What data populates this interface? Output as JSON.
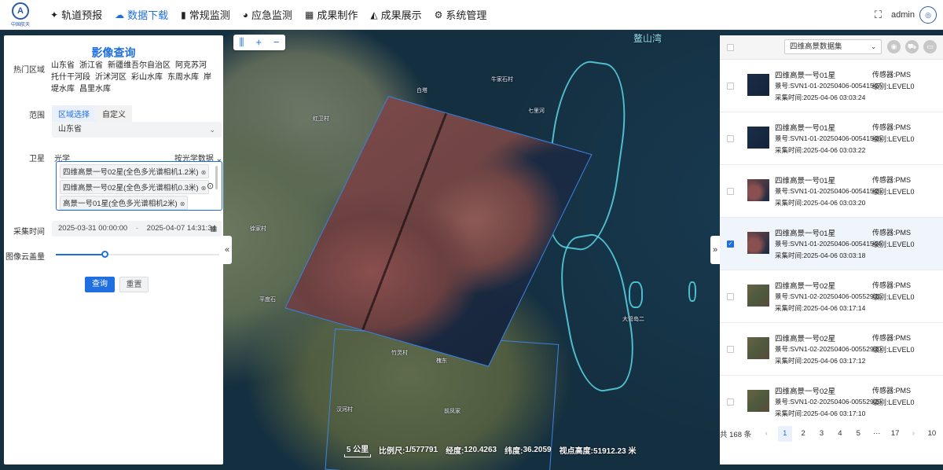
{
  "nav": {
    "logo_text": "中国航天",
    "items": [
      {
        "icon": "satellite-icon",
        "glyph": "✦",
        "label": "轨道预报"
      },
      {
        "icon": "cloud-download-icon",
        "glyph": "☁",
        "label": "数据下载"
      },
      {
        "icon": "map-icon",
        "glyph": "▮",
        "label": "常规监测"
      },
      {
        "icon": "pie-chart-icon",
        "glyph": "◕",
        "label": "应急监测"
      },
      {
        "icon": "table-icon",
        "glyph": "▦",
        "label": "成果制作"
      },
      {
        "icon": "area-chart-icon",
        "glyph": "◭",
        "label": "成果展示"
      },
      {
        "icon": "gear-icon",
        "glyph": "⚙",
        "label": "系统管理"
      }
    ],
    "active_index": 1,
    "user": "admin"
  },
  "map": {
    "tools": {
      "layers": "⫼",
      "zoom_in": "+",
      "zoom_out": "−"
    },
    "labels": [
      "鳌山湾",
      "大管岛二",
      "白塔",
      "牛家石村",
      "七里河",
      "红卫村",
      "徐家村",
      "平度石",
      "槐东",
      "竹灵村",
      "前凤家",
      "汉河村"
    ],
    "status": {
      "scale_text": "5 公里",
      "scale_ratio_label": "比例尺:",
      "scale_ratio": "1/577791",
      "lon_label": "经度:",
      "lon": "120.4263",
      "lat_label": "纬度:",
      "lat": "36.2059",
      "alt_label": "视点高度:",
      "alt": "51912.23 米"
    }
  },
  "left_panel": {
    "title": "影像查询",
    "hot_label": "热门区域",
    "hot_areas": [
      "山东省",
      "浙江省",
      "新疆维吾尔自治区",
      "阿克苏河",
      "托什干河段",
      "沂沭河区",
      "彩山水库",
      "东周水库",
      "岸堤水库",
      "昌里水库"
    ],
    "range_label": "范围",
    "tabs": [
      "区域选择",
      "自定义"
    ],
    "active_tab": 0,
    "province": "山东省",
    "satellite_label": "卫星",
    "sat_category": "光学",
    "sat_type": "按光学数据",
    "sat_tags": [
      "四维高景一号02星(全色多光谱相机1.2米)",
      "四维高景一号02星(全色多光谱相机0.3米)",
      "高景一号01星(全色多光谱相机2米)",
      "高景一号01星(全色多光谱相机0.5米)"
    ],
    "time_label": "采集时间",
    "start_time": "2025-03-31 00:00:00",
    "time_sep": "-",
    "end_time": "2025-04-07 14:31:34",
    "cloud_label": "图像云盖量",
    "cloud_value": 0.3,
    "query_btn": "查询",
    "reset_btn": "重置",
    "collapse": "«"
  },
  "right_panel": {
    "dataset": "四维高景数据集",
    "collapse": "»",
    "scenes": [
      {
        "name": "四维高景一号01星",
        "sensor": "传感器:PMS",
        "id": "景号:SVN1-01-20250406-00541547",
        "level": "级别:LEVEL0",
        "time": "采集时间:2025-04-06 03:03:24",
        "checked": false,
        "thumb": "ocean"
      },
      {
        "name": "四维高景一号01星",
        "sensor": "传感器:PMS",
        "id": "景号:SVN1-01-20250406-00541546",
        "level": "级别:LEVEL0",
        "time": "采集时间:2025-04-06 03:03:22",
        "checked": false,
        "thumb": "ocean"
      },
      {
        "name": "四维高景一号01星",
        "sensor": "传感器:PMS",
        "id": "景号:SVN1-01-20250406-00541545",
        "level": "级别:LEVEL0",
        "time": "采集时间:2025-04-06 03:03:20",
        "checked": false,
        "thumb": "coast"
      },
      {
        "name": "四维高景一号01星",
        "sensor": "传感器:PMS",
        "id": "景号:SVN1-01-20250406-00541544",
        "level": "级别:LEVEL0",
        "time": "采集时间:2025-04-06 03:03:18",
        "checked": true,
        "thumb": "coast"
      },
      {
        "name": "四维高景一号02星",
        "sensor": "传感器:PMS",
        "id": "景号:SVN1-02-20250406-00552931",
        "level": "级别:LEVEL0",
        "time": "采集时间:2025-04-06 03:17:14",
        "checked": false,
        "thumb": "land"
      },
      {
        "name": "四维高景一号02星",
        "sensor": "传感器:PMS",
        "id": "景号:SVN1-02-20250406-00552930",
        "level": "级别:LEVEL0",
        "time": "采集时间:2025-04-06 03:17:12",
        "checked": false,
        "thumb": "land"
      },
      {
        "name": "四维高景一号02星",
        "sensor": "传感器:PMS",
        "id": "景号:SVN1-02-20250406-00552929",
        "level": "级别:LEVEL0",
        "time": "采集时间:2025-04-06 03:17:10",
        "checked": false,
        "thumb": "land"
      }
    ],
    "pager": {
      "total": "共 168 条",
      "prev": "‹",
      "pages": [
        "1",
        "2",
        "3",
        "4",
        "5",
        "···",
        "17"
      ],
      "next": "›",
      "size": "10"
    },
    "active_page": 0
  },
  "colors": {
    "accent": "#1f6fe0",
    "footprint": "#3f83e0",
    "coastline": "#58d7e6"
  }
}
